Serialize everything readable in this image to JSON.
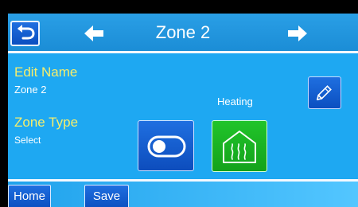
{
  "header": {
    "title": "Zone 2"
  },
  "edit_name": {
    "label": "Edit Name",
    "value": "Zone 2"
  },
  "zone_type": {
    "label": "Zone Type",
    "sub_label": "Select",
    "current_mode": "Heating"
  },
  "footer": {
    "home_label": "Home",
    "save_label": "Save"
  },
  "icons": [
    "back-icon",
    "left-arrow-icon",
    "right-arrow-icon",
    "pencil-icon",
    "toggle-icon",
    "heating-house-icon"
  ]
}
